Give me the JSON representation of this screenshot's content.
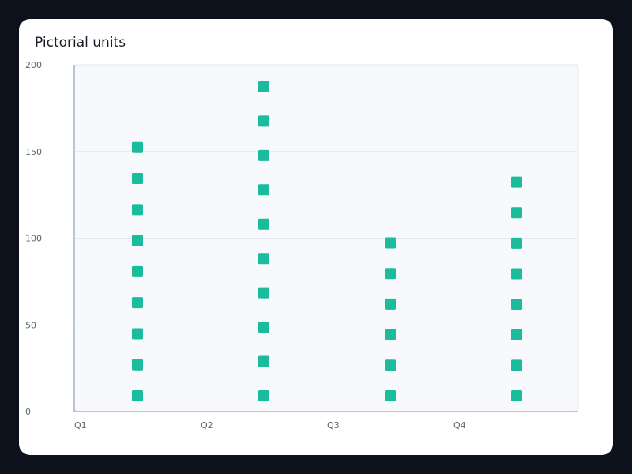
{
  "chart_data": {
    "type": "bar",
    "title": "Pictorial units",
    "xlabel": "",
    "ylabel": "",
    "categories": [
      "Q1",
      "Q2",
      "Q3",
      "Q4"
    ],
    "series": [
      {
        "values": [
          155,
          190,
          100,
          135
        ]
      }
    ],
    "units_per_category": [
      9,
      10,
      6,
      8
    ],
    "ylim": [
      0,
      200
    ],
    "yticks": [
      0,
      50,
      100,
      150,
      200
    ],
    "grid": true,
    "legend": "none",
    "colors": {
      "unit": "#1abc9c",
      "plot_bg": "#f7f9fd",
      "grid": "#e4e9f2",
      "axis": "#a8b4c8"
    }
  }
}
